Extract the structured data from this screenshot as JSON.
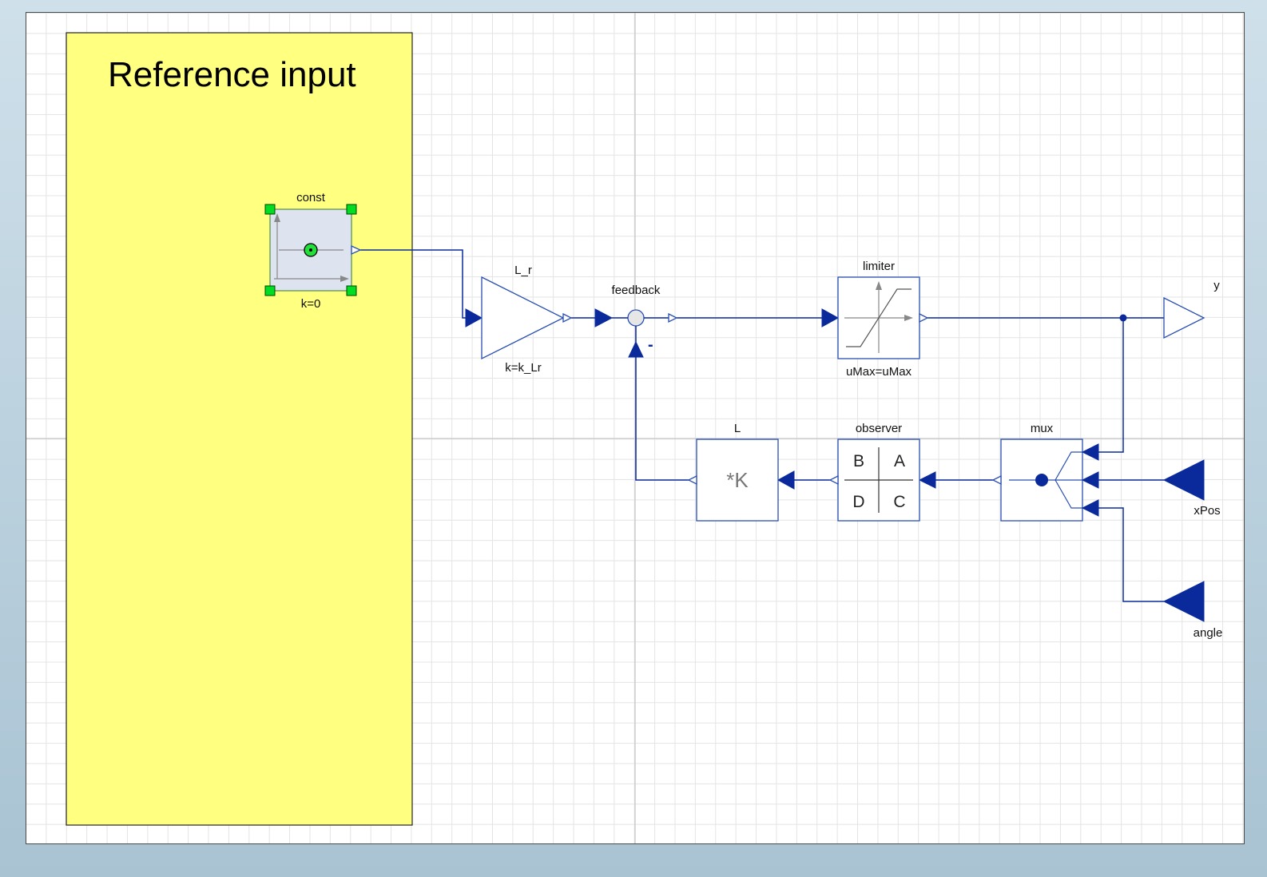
{
  "diagram": {
    "note": {
      "title": "Reference input"
    },
    "blocks": {
      "const": {
        "name": "const",
        "param": "k=0"
      },
      "gain_lr": {
        "name": "L_r",
        "param": "k=k_Lr"
      },
      "feedback": {
        "name": "feedback",
        "sign": "-"
      },
      "limiter": {
        "name": "limiter",
        "param": "uMax=uMax"
      },
      "L": {
        "name": "L",
        "glyph": "*K"
      },
      "observer": {
        "name": "observer",
        "cells": [
          "B",
          "A",
          "D",
          "C"
        ]
      },
      "mux": {
        "name": "mux"
      }
    },
    "ports": {
      "y": "y",
      "xPos": "xPos",
      "angle": "angle"
    },
    "colors": {
      "connection": "#0a2a9c",
      "block_border": "#2a4fb4",
      "note_fill": "#ffff80",
      "selection_handle": "#00dd22"
    }
  }
}
